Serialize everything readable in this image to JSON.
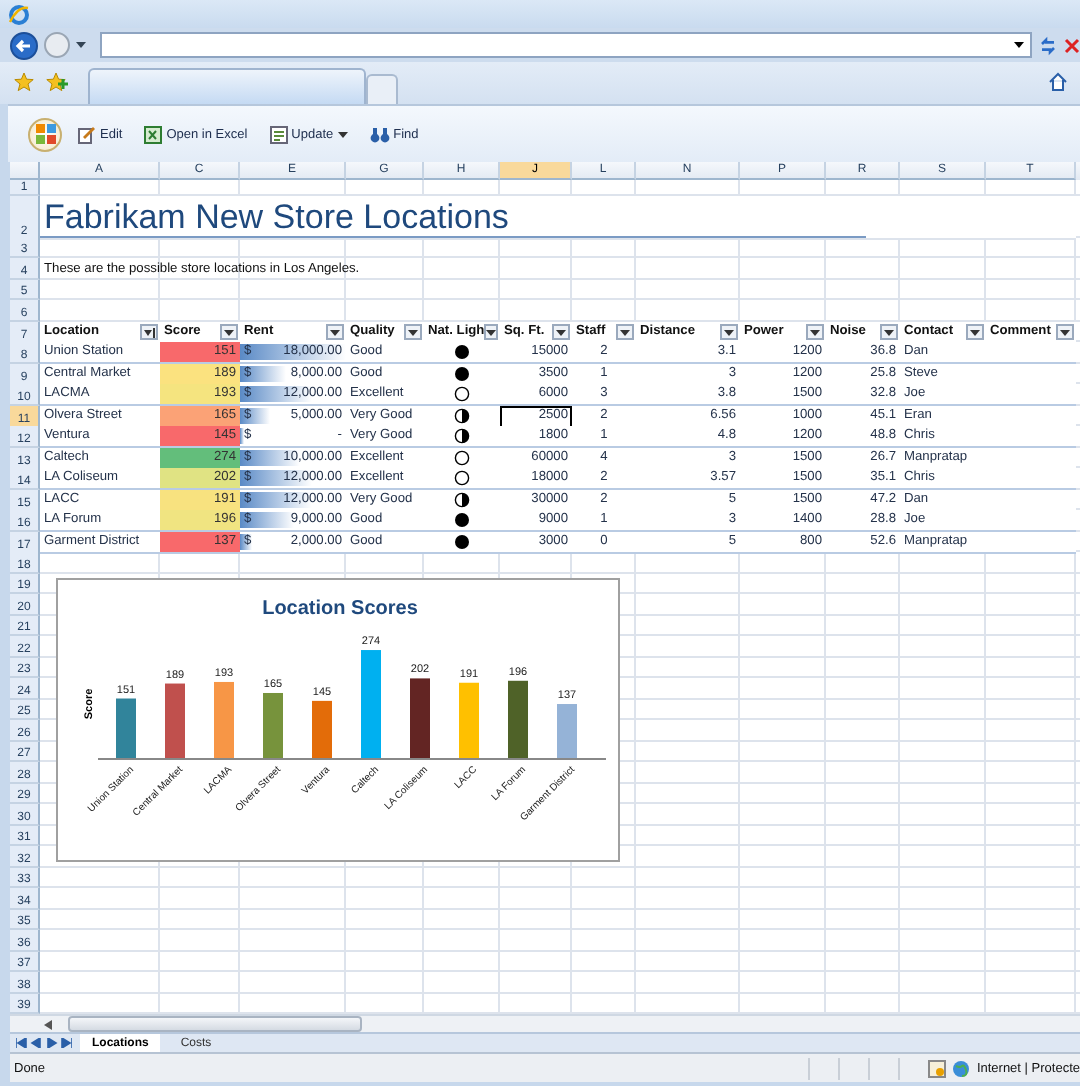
{
  "toolbar": {
    "buttons": [
      {
        "label": "Edit",
        "kind": "edit",
        "menu": false
      },
      {
        "label": "Open in Excel",
        "kind": "excel",
        "menu": false
      },
      {
        "label": "Update",
        "kind": "update",
        "menu": true
      },
      {
        "label": "Find",
        "kind": "find",
        "menu": false
      }
    ]
  },
  "sheet": {
    "columns": [
      {
        "label": "A",
        "selected": false
      },
      {
        "label": "C",
        "selected": false
      },
      {
        "label": "E",
        "selected": false
      },
      {
        "label": "G",
        "selected": false
      },
      {
        "label": "H",
        "selected": false
      },
      {
        "label": "J",
        "selected": true
      },
      {
        "label": "L",
        "selected": false
      },
      {
        "label": "N",
        "selected": false
      },
      {
        "label": "P",
        "selected": false
      },
      {
        "label": "R",
        "selected": false
      },
      {
        "label": "S",
        "selected": false
      },
      {
        "label": "T",
        "selected": false
      }
    ],
    "row_headers": [
      {
        "label": "1",
        "selected": false
      },
      {
        "label": "2",
        "selected": false
      },
      {
        "label": "3",
        "selected": false
      },
      {
        "label": "4",
        "selected": false
      },
      {
        "label": "5",
        "selected": false
      },
      {
        "label": "6",
        "selected": false
      },
      {
        "label": "7",
        "selected": false
      },
      {
        "label": "8",
        "selected": false
      },
      {
        "label": "9",
        "selected": false
      },
      {
        "label": "10",
        "selected": false
      },
      {
        "label": "11",
        "selected": true
      },
      {
        "label": "12",
        "selected": false
      },
      {
        "label": "13",
        "selected": false
      },
      {
        "label": "14",
        "selected": false
      },
      {
        "label": "15",
        "selected": false
      },
      {
        "label": "16",
        "selected": false
      },
      {
        "label": "17",
        "selected": false
      },
      {
        "label": "18",
        "selected": false
      },
      {
        "label": "19",
        "selected": false
      },
      {
        "label": "20",
        "selected": false
      },
      {
        "label": "21",
        "selected": false
      },
      {
        "label": "22",
        "selected": false
      },
      {
        "label": "23",
        "selected": false
      },
      {
        "label": "24",
        "selected": false
      },
      {
        "label": "25",
        "selected": false
      },
      {
        "label": "26",
        "selected": false
      },
      {
        "label": "27",
        "selected": false
      },
      {
        "label": "28",
        "selected": false
      },
      {
        "label": "29",
        "selected": false
      },
      {
        "label": "30",
        "selected": false
      },
      {
        "label": "31",
        "selected": false
      },
      {
        "label": "32",
        "selected": false
      },
      {
        "label": "33",
        "selected": false
      },
      {
        "label": "34",
        "selected": false
      },
      {
        "label": "35",
        "selected": false
      },
      {
        "label": "36",
        "selected": false
      },
      {
        "label": "37",
        "selected": false
      },
      {
        "label": "38",
        "selected": false
      },
      {
        "label": "39",
        "selected": false
      }
    ],
    "title": "Fabrikam New Store Locations",
    "description": "These are the possible store locations in Los Angeles.",
    "table": {
      "columns": [
        {
          "label": "Location",
          "kind": "sort"
        },
        {
          "label": "Score",
          "kind": "filter"
        },
        {
          "label": "Rent",
          "kind": "filter"
        },
        {
          "label": "Quality",
          "kind": "filter"
        },
        {
          "label": "Nat. Ligh",
          "kind": "filter"
        },
        {
          "label": "Sq. Ft.",
          "kind": "filter"
        },
        {
          "label": "Staff",
          "kind": "filter"
        },
        {
          "label": "Distance",
          "kind": "filter"
        },
        {
          "label": "Power",
          "kind": "filter"
        },
        {
          "label": "Noise",
          "kind": "filter"
        },
        {
          "label": "Contact",
          "kind": "filter"
        },
        {
          "label": "Comment",
          "kind": "filter"
        }
      ],
      "rows": [
        {
          "location": "Union Station",
          "score": "151",
          "color": "#f8696b",
          "currency": "$",
          "rent": "18,000.00",
          "level": 1,
          "quality": "Good",
          "light": {
            "kind": "full"
          },
          "sq_ft": "15000",
          "staff": "2",
          "distance": "3.1",
          "power": "1200",
          "noise": "36.8",
          "contact": "Dan"
        },
        {
          "location": "Central Market",
          "score": "189",
          "color": "#fbe27f",
          "currency": "$",
          "rent": "8,000.00",
          "level": 0.44,
          "quality": "Good",
          "light": {
            "kind": "full"
          },
          "sq_ft": "3500",
          "staff": "1",
          "distance": "3",
          "power": "1200",
          "noise": "25.8",
          "contact": "Steve"
        },
        {
          "location": "LACMA",
          "score": "193",
          "color": "#f5e47f",
          "currency": "$",
          "rent": "12,000.00",
          "level": 0.67,
          "quality": "Excellent",
          "light": {
            "kind": "empty"
          },
          "sq_ft": "6000",
          "staff": "3",
          "distance": "3.8",
          "power": "1500",
          "noise": "32.8",
          "contact": "Joe"
        },
        {
          "location": "Olvera Street",
          "score": "165",
          "color": "#fba276",
          "currency": "$",
          "rent": "5,000.00",
          "level": 0.28,
          "quality": "Very Good",
          "light": {
            "kind": "half"
          },
          "sq_ft": "2500",
          "staff": "2",
          "distance": "6.56",
          "power": "1000",
          "noise": "45.1",
          "contact": "Eran"
        },
        {
          "location": "Ventura",
          "score": "145",
          "color": "#f8696b",
          "currency": "$",
          "rent": "-",
          "level": 0,
          "quality": "Very Good",
          "light": {
            "kind": "half"
          },
          "sq_ft": "1800",
          "staff": "1",
          "distance": "4.8",
          "power": "1200",
          "noise": "48.8",
          "contact": "Chris"
        },
        {
          "location": "Caltech",
          "score": "274",
          "color": "#63be7b",
          "currency": "$",
          "rent": "10,000.00",
          "level": 0.56,
          "quality": "Excellent",
          "light": {
            "kind": "empty"
          },
          "sq_ft": "60000",
          "staff": "4",
          "distance": "3",
          "power": "1500",
          "noise": "26.7",
          "contact": "Manpratap"
        },
        {
          "location": "LA Coliseum",
          "score": "202",
          "color": "#e0e383",
          "currency": "$",
          "rent": "12,000.00",
          "level": 0.67,
          "quality": "Excellent",
          "light": {
            "kind": "empty"
          },
          "sq_ft": "18000",
          "staff": "2",
          "distance": "3.57",
          "power": "1500",
          "noise": "35.1",
          "contact": "Chris"
        },
        {
          "location": "LACC",
          "score": "191",
          "color": "#f8e27f",
          "currency": "$",
          "rent": "12,000.00",
          "level": 0.67,
          "quality": "Very Good",
          "light": {
            "kind": "half"
          },
          "sq_ft": "30000",
          "staff": "2",
          "distance": "5",
          "power": "1500",
          "noise": "47.2",
          "contact": "Dan"
        },
        {
          "location": "LA Forum",
          "score": "196",
          "color": "#f0e481",
          "currency": "$",
          "rent": "9,000.00",
          "level": 0.5,
          "quality": "Good",
          "light": {
            "kind": "full"
          },
          "sq_ft": "9000",
          "staff": "1",
          "distance": "3",
          "power": "1400",
          "noise": "28.8",
          "contact": "Joe"
        },
        {
          "location": "Garment District",
          "score": "137",
          "color": "#f8696b",
          "currency": "$",
          "rent": "2,000.00",
          "level": 0.11,
          "quality": "Good",
          "light": {
            "kind": "full"
          },
          "sq_ft": "3000",
          "staff": "0",
          "distance": "5",
          "power": "800",
          "noise": "52.6",
          "contact": "Manpratap"
        }
      ]
    },
    "chart": {
      "chart_data": {
        "type": "bar",
        "title": "Location Scores",
        "ylabel": "Score",
        "data_labels": true,
        "categories": [
          "Union Station",
          "Central Market",
          "LACMA",
          "Olvera Street",
          "Ventura",
          "Caltech",
          "LA Coliseum",
          "LACC",
          "LA Forum",
          "Garment District"
        ],
        "series": [
          {
            "colors": [
              "#31849b",
              "#c0504d",
              "#f79646",
              "#77933c",
              "#e36c09",
              "#00b0f0",
              "#632523",
              "#ffc000",
              "#4f6228",
              "#95b3d7"
            ],
            "values": [
              151,
              189,
              193,
              165,
              145,
              274,
              202,
              191,
              196,
              137
            ]
          }
        ]
      }
    }
  },
  "sheet_tabs": [
    {
      "label": "Locations",
      "selected": true
    },
    {
      "label": "Costs",
      "selected": false
    }
  ],
  "status_bar": {
    "text": "Done",
    "zone": "Internet | Protecte"
  }
}
